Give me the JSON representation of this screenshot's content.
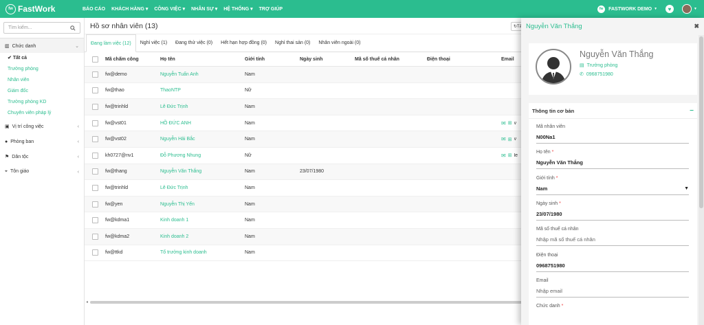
{
  "brand": {
    "logo_mark": "fw",
    "name": "FastWork"
  },
  "nav": [
    "BÁO CÁO",
    "KHÁCH HÀNG ▾",
    "CÔNG VIỆC ▾",
    "NHÂN SỰ ▾",
    "HỆ THỐNG ▾",
    "TRỢ GIÚP"
  ],
  "account": {
    "mark": "fw",
    "name": "FASTWORK DEMO"
  },
  "sidebar": {
    "search_placeholder": "Tìm kiếm...",
    "groups": [
      {
        "label": "Chức danh",
        "icon": "building-icon",
        "open": true,
        "items": [
          "Tất cả",
          "Trưởng phòng",
          "Nhân viên",
          "Giám đốc",
          "Trưởng phòng KD",
          "Chuyên viên pháp lý"
        ]
      },
      {
        "label": "Vị trí công việc",
        "icon": "briefcase-icon"
      },
      {
        "label": "Phòng ban",
        "icon": "user-icon"
      },
      {
        "label": "Dân tộc",
        "icon": "flag-icon"
      },
      {
        "label": "Tôn giáo",
        "icon": "pin-icon"
      }
    ]
  },
  "main": {
    "title": "Hồ sơ nhân viên (13)",
    "refresh_label": "Tả",
    "tabs": [
      "Đang làm việc (12)",
      "Nghỉ việc (1)",
      "Đang thử việc (0)",
      "Hết hạn hợp đồng (0)",
      "Nghỉ thai sản (0)",
      "Nhân viên ngoài (0)"
    ],
    "columns": [
      "Mã chấm công",
      "Họ tên",
      "Giới tính",
      "Ngày sinh",
      "Mã số thuế cá nhân",
      "Điện thoại",
      "Email"
    ],
    "rows": [
      {
        "code": "fw@demo",
        "name": "Nguyễn Tuấn Anh",
        "gender": "Nam",
        "dob": "",
        "email_icons": false,
        "email": ""
      },
      {
        "code": "fw@thao",
        "name": "ThaoNTP",
        "gender": "Nữ",
        "dob": "",
        "email_icons": false,
        "email": ""
      },
      {
        "code": "fw@trinhld",
        "name": "Lê Đức Trịnh",
        "gender": "Nam",
        "dob": "",
        "email_icons": false,
        "email": ""
      },
      {
        "code": "fw@vst01",
        "name": "HỒ ĐỨC ANH",
        "gender": "Nam",
        "dob": "",
        "email_icons": true,
        "email": "v"
      },
      {
        "code": "fw@vst02",
        "name": "Nguyễn Hải Bắc",
        "gender": "Nam",
        "dob": "",
        "email_icons": true,
        "email": "v"
      },
      {
        "code": "kh0727@nv1",
        "name": "Đỗ Phương Nhung",
        "gender": "Nữ",
        "dob": "",
        "email_icons": true,
        "email": "le"
      },
      {
        "code": "fw@thang",
        "name": "Nguyễn Văn Thắng",
        "gender": "Nam",
        "dob": "23/07/1980",
        "email_icons": false,
        "email": ""
      },
      {
        "code": "fw@trinhld",
        "name": "Lê Đức Trịnh",
        "gender": "Nam",
        "dob": "",
        "email_icons": false,
        "email": ""
      },
      {
        "code": "fw@yen",
        "name": "Nguyễn Thị Yến",
        "gender": "Nam",
        "dob": "",
        "email_icons": false,
        "email": ""
      },
      {
        "code": "fw@kdma1",
        "name": "Kinh doanh 1",
        "gender": "Nam",
        "dob": "",
        "email_icons": false,
        "email": ""
      },
      {
        "code": "fw@kdma2",
        "name": "Kinh doanh 2",
        "gender": "Nam",
        "dob": "",
        "email_icons": false,
        "email": ""
      },
      {
        "code": "fw@ttkd",
        "name": "Tổ trưởng kinh doanh",
        "gender": "Nam",
        "dob": "",
        "email_icons": false,
        "email": ""
      }
    ]
  },
  "panel": {
    "title": "Nguyễn Văn Thắng",
    "name": "Nguyễn Văn Thắng",
    "role": "Trưởng phòng",
    "phone": "0968751980",
    "section_title": "Thông tin cơ bản",
    "fields": [
      {
        "label": "Mã nhân viên",
        "required": false,
        "value": "N00Na1",
        "placeholder": false,
        "select": false
      },
      {
        "label": "Họ tên",
        "required": true,
        "value": "Nguyễn Văn Thắng",
        "placeholder": false,
        "select": false
      },
      {
        "label": "Giới tính",
        "required": true,
        "value": "Nam",
        "placeholder": false,
        "select": true
      },
      {
        "label": "Ngày sinh",
        "required": true,
        "value": "23/07/1980",
        "placeholder": false,
        "select": false
      },
      {
        "label": "Mã số thuế cá nhân",
        "required": false,
        "value": "Nhập mã số thuế cá nhân",
        "placeholder": true,
        "select": false
      },
      {
        "label": "Điện thoại",
        "required": false,
        "value": "0968751980",
        "placeholder": false,
        "select": false
      },
      {
        "label": "Email",
        "required": false,
        "value": "Nhập email",
        "placeholder": true,
        "select": false
      },
      {
        "label": "Chức danh",
        "required": true,
        "value": "",
        "placeholder": false,
        "select": false
      }
    ]
  }
}
